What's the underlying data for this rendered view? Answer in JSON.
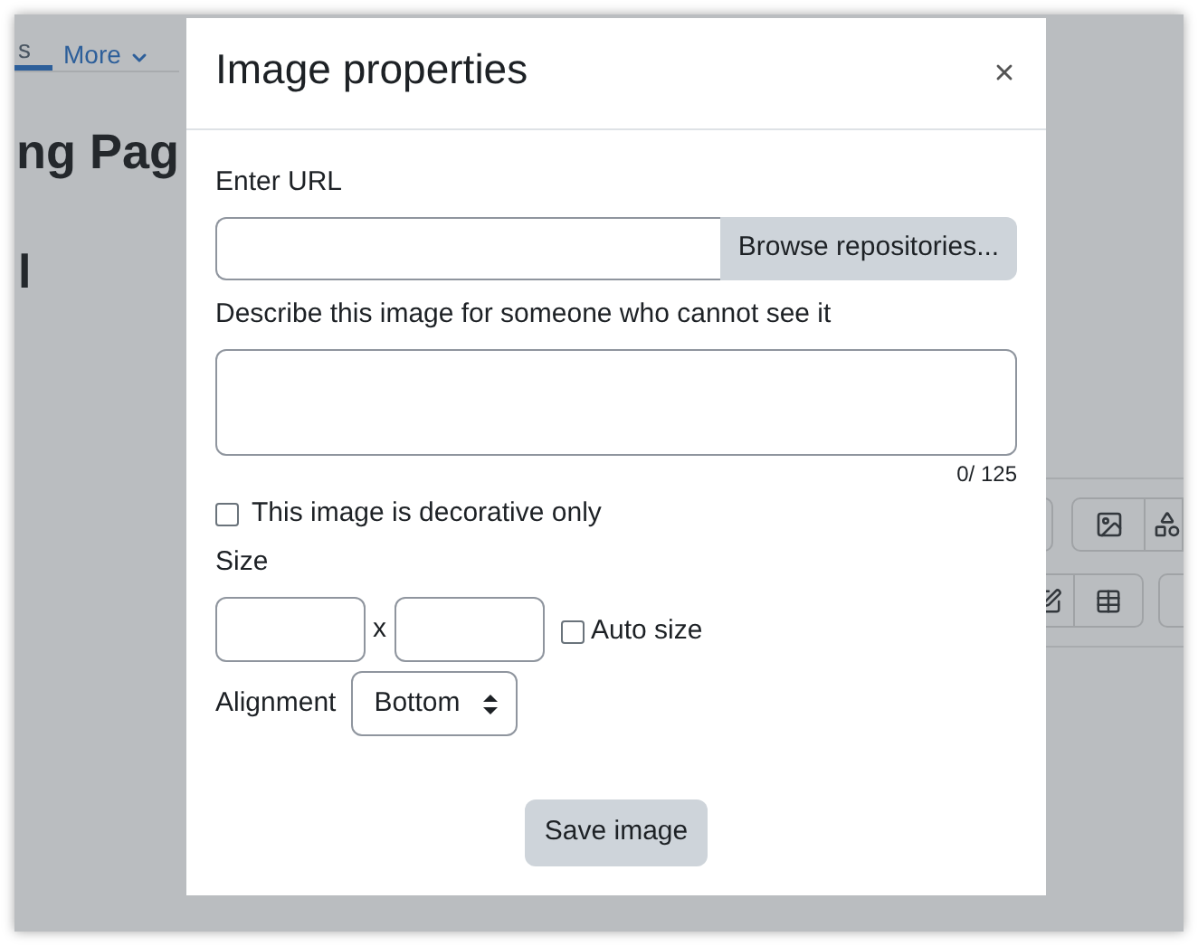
{
  "background": {
    "nav_tabs": [
      {
        "label": "s",
        "selected": true
      },
      {
        "label": "More",
        "selected": false
      }
    ],
    "heading": "ng Pag",
    "subheading": "l"
  },
  "dialog": {
    "title": "Image properties",
    "url_label": "Enter URL",
    "browse_button": "Browse repositories...",
    "alt_label": "Describe this image for someone who cannot see it",
    "char_count": "0/ 125",
    "decorative": {
      "label": "This image is decorative only",
      "checked": false
    },
    "size_label": "Size",
    "size_separator": "x",
    "auto_size": {
      "label": "Auto size",
      "checked": false
    },
    "alignment_label": "Alignment",
    "alignment_value": "Bottom",
    "save_button": "Save image"
  }
}
